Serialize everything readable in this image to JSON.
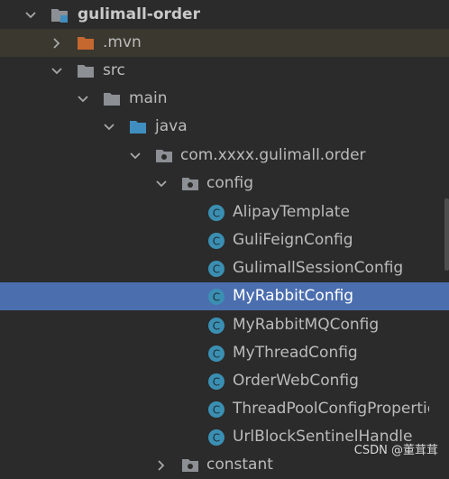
{
  "project_tree": {
    "root_label": "gulimall-order",
    "mvn_label": ".mvn",
    "src_label": "src",
    "main_label": "main",
    "java_label": "java",
    "package_label": "com.xxxx.gulimall.order",
    "config_label": "config",
    "classes": [
      "AlipayTemplate",
      "GuliFeignConfig",
      "GulimallSessionConfig",
      "MyRabbitConfig",
      "MyRabbitMQConfig",
      "MyThreadConfig",
      "OrderWebConfig",
      "ThreadPoolConfigPropertie",
      "UrlBlockSentinelHandler"
    ],
    "selected_class": "MyRabbitConfig",
    "next_package_label": "constant",
    "class_icon_letter": "C"
  },
  "watermark": "CSDN @董茸茸",
  "colors": {
    "background": "#2b2b2b",
    "selection": "#4b6eaf",
    "hover_row": "#3a382f",
    "folder_gray": "#8c8f93",
    "excluded_folder": "#c5682f",
    "source_folder": "#3f8ebf",
    "class_icon": "#3a8fb2"
  },
  "icons": {
    "expanded_arrow": "chevron-down-icon",
    "collapsed_arrow": "chevron-right-icon",
    "module": "module-icon",
    "folder": "folder-icon",
    "package": "package-icon",
    "class": "class-icon"
  }
}
